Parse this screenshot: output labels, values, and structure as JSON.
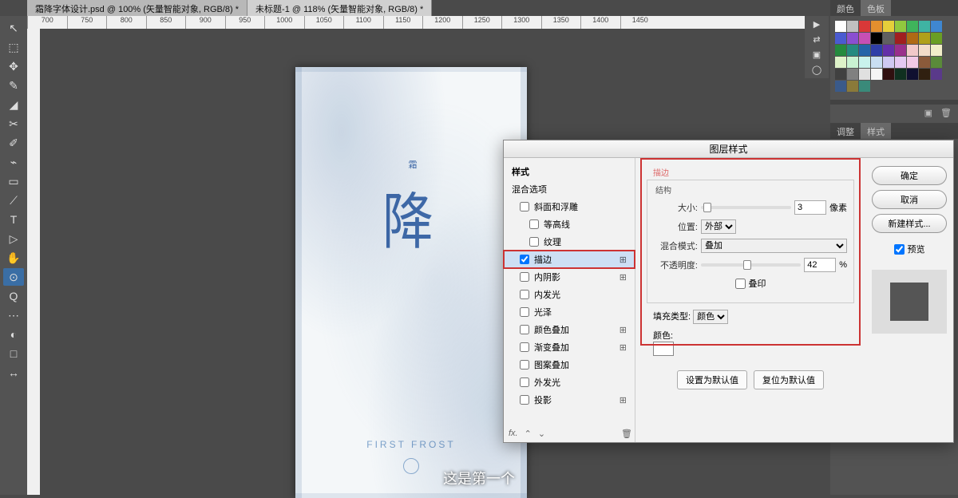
{
  "tabs": [
    {
      "label": "霜降字体设计.psd @ 100% (矢量智能对象, RGB/8) *"
    },
    {
      "label": "未标题-1 @ 118% (矢量智能对象, RGB/8) *"
    }
  ],
  "active_tab": 1,
  "ruler_marks": [
    "700",
    "750",
    "800",
    "850",
    "900",
    "950",
    "1000",
    "1050",
    "1100",
    "1150",
    "1200",
    "1250",
    "1300",
    "1350",
    "1400",
    "1450"
  ],
  "tools": [
    "↖",
    "⬚",
    "✥",
    "✎",
    "◢",
    "✂",
    "✐",
    "⌁",
    "▭",
    "⟋",
    "T",
    "▷",
    "✋",
    "⊙",
    "Q",
    "⋯",
    "◐",
    "□",
    "↔"
  ],
  "selected_tool": 13,
  "artwork": {
    "line1": "霜",
    "line2": "降",
    "subtitle": "FIRST FROST"
  },
  "caption": "这是第一个",
  "right_panels": {
    "top_tabs": [
      "颜色",
      "色板"
    ],
    "adjust_tabs": [
      "调整",
      "样式"
    ]
  },
  "swatch_colors": [
    "#ffffff",
    "#c0c0c0",
    "#d93838",
    "#e38f2e",
    "#e6cf3a",
    "#92c83e",
    "#3fb45b",
    "#3fb4a3",
    "#3f87d1",
    "#4a5bd1",
    "#8a4fd1",
    "#c74fb5",
    "#000000",
    "#606060",
    "#a11f1f",
    "#b06a14",
    "#b0a01a",
    "#6a9e24",
    "#258a3e",
    "#258a80",
    "#2564a8",
    "#2f3ea8",
    "#6430a8",
    "#9a308c",
    "#f2c9c9",
    "#f2dcc9",
    "#f2eec9",
    "#def2c9",
    "#c9f2d2",
    "#c9f2ec",
    "#c9def2",
    "#cfc9f2",
    "#e4c9f2",
    "#f2c9e6",
    "#8a5a3a",
    "#5a8a3a",
    "#404040",
    "#808080",
    "#e0e0e0",
    "#f5f5f5",
    "#301010",
    "#103020",
    "#101030",
    "#302010",
    "#5a3a8a",
    "#3a5a8a",
    "#8a7a3a",
    "#3a8a7a"
  ],
  "dialog": {
    "title": "图层样式",
    "styles_header": "样式",
    "blend_header": "混合选项",
    "effects": [
      {
        "label": "斜面和浮雕",
        "checked": false,
        "plus": false
      },
      {
        "label": "等高线",
        "checked": false,
        "plus": false,
        "indent": true
      },
      {
        "label": "纹理",
        "checked": false,
        "plus": false,
        "indent": true
      },
      {
        "label": "描边",
        "checked": true,
        "plus": true,
        "highlight": true
      },
      {
        "label": "内阴影",
        "checked": false,
        "plus": true
      },
      {
        "label": "内发光",
        "checked": false,
        "plus": false
      },
      {
        "label": "光泽",
        "checked": false,
        "plus": false
      },
      {
        "label": "颜色叠加",
        "checked": false,
        "plus": true
      },
      {
        "label": "渐变叠加",
        "checked": false,
        "plus": true
      },
      {
        "label": "图案叠加",
        "checked": false,
        "plus": false
      },
      {
        "label": "外发光",
        "checked": false,
        "plus": false
      },
      {
        "label": "投影",
        "checked": false,
        "plus": true
      }
    ],
    "structure": {
      "group_label": "描边",
      "sub_label": "结构",
      "size_label": "大小:",
      "size_value": "3",
      "size_unit": "像素",
      "position_label": "位置:",
      "position_value": "外部",
      "blend_label": "混合模式:",
      "blend_value": "叠加",
      "opacity_label": "不透明度:",
      "opacity_value": "42",
      "opacity_unit": "%",
      "overprint_label": "叠印",
      "overprint_checked": false,
      "fill_label": "填充类型:",
      "fill_value": "颜色",
      "color_label": "颜色:",
      "color_value": "#ffffff"
    },
    "defaults": {
      "set": "设置为默认值",
      "reset": "复位为默认值"
    },
    "buttons": {
      "ok": "确定",
      "cancel": "取消",
      "new": "新建样式...",
      "preview": "预览"
    },
    "preview_checked": true
  }
}
